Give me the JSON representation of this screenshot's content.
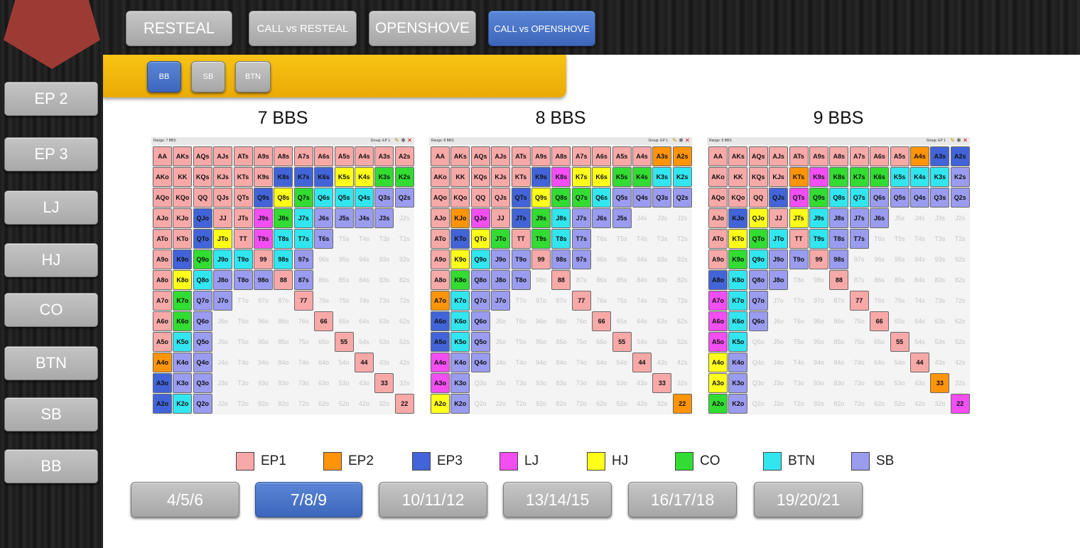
{
  "colors": {
    "EP1": "#f7a9a8",
    "EP2": "#ff9408",
    "EP3": "#4264d8",
    "LJ": "#f24ef2",
    "HJ": "#ffff19",
    "CO": "#32dc32",
    "BTN": "#32e6f0",
    "SB": "#9a9cf0"
  },
  "ranks": [
    "A",
    "K",
    "Q",
    "J",
    "T",
    "9",
    "8",
    "7",
    "6",
    "5",
    "4",
    "3",
    "2"
  ],
  "sidebar": {
    "items": [
      "EP 2",
      "EP 3",
      "LJ",
      "HJ",
      "CO",
      "BTN",
      "SB",
      "BB"
    ]
  },
  "top_tabs": [
    {
      "label": "RESTEAL",
      "active": false
    },
    {
      "label": "CALL vs RESTEAL",
      "active": false
    },
    {
      "label": "OPENSHOVE",
      "active": false
    },
    {
      "label": "CALL vs OPENSHOVE",
      "active": true
    }
  ],
  "position_tabs": [
    {
      "label": "BB",
      "active": true
    },
    {
      "label": "SB",
      "active": false
    },
    {
      "label": "BTN",
      "active": false
    }
  ],
  "grids": [
    {
      "title": "7 BBS",
      "range_label": "Range: 7 BBS",
      "group_label": "Group: EP 1",
      "rows": [
        "EP1 EP1 EP1 EP1 EP1 EP1 EP1 EP1 EP1 EP1 EP1 EP1 EP1",
        "EP1 EP1 EP1 EP1 EP1 EP1 EP3 EP3 EP3 HJ HJ CO CO",
        "EP1 EP1 EP1 EP1 EP1 EP3 HJ CO BTN BTN BTN SB SB",
        "EP1 EP1 EP3 EP1 EP1 LJ CO BTN SB SB SB SB -",
        "EP1 EP1 EP3 HJ EP1 LJ BTN BTN SB - - - -",
        "EP1 EP3 CO BTN BTN EP1 BTN SB - - - - -",
        "EP1 HJ BTN SB SB SB EP1 SB - - - - -",
        "EP1 CO SB SB - - - EP1 - - - - -",
        "EP1 CO SB - - - - - EP1 - - - -",
        "EP1 BTN SB - - - - - - EP1 - - -",
        "EP2 SB SB - - - - - - - EP1 - -",
        "EP3 SB SB - - - - - - - - EP1 -",
        "EP3 BTN SB - - - - - - - - - EP1"
      ]
    },
    {
      "title": "8 BBS",
      "range_label": "Range: 8 BBS",
      "group_label": "Group: EP 1",
      "rows": [
        "EP1 EP1 EP1 EP1 EP1 EP1 EP1 EP1 EP1 EP1 EP1 EP2 EP2",
        "EP1 EP1 EP1 EP1 EP1 EP3 LJ HJ HJ CO CO BTN BTN",
        "EP1 EP1 EP1 EP1 EP3 HJ CO CO BTN SB SB SB SB",
        "EP1 EP2 LJ EP1 EP3 CO BTN SB SB SB - - -",
        "EP1 EP3 HJ CO EP1 CO BTN SB - - - - -",
        "EP1 HJ BTN SB SB EP1 SB SB - - - - -",
        "EP1 CO SB SB SB - EP1 - - - - - -",
        "EP2 BTN SB SB - - - EP1 - - - - -",
        "EP3 BTN SB - - - - - EP1 - - - -",
        "EP3 BTN SB - - - - - - EP1 - - -",
        "LJ SB SB - - - - - - - EP1 - -",
        "LJ SB - - - - - - - - - EP1 -",
        "HJ SB - - - - - - - - - - EP2"
      ]
    },
    {
      "title": "9 BBS",
      "range_label": "Range: 9 BBS",
      "group_label": "Group: EP 1",
      "rows": [
        "EP1 EP1 EP1 EP1 EP1 EP1 EP1 EP1 EP1 EP1 EP2 EP3 EP3",
        "EP1 EP1 EP1 EP1 EP2 LJ CO CO CO BTN BTN BTN SB",
        "EP1 EP1 EP1 EP3 LJ CO BTN BTN SB SB SB SB SB",
        "EP1 EP3 HJ EP1 HJ BTN SB SB SB - - - -",
        "EP1 HJ CO BTN EP1 BTN SB SB - - - - -",
        "EP1 CO BTN SB SB EP1 SB - - - - - -",
        "EP3 BTN SB SB - - EP1 - - - - - -",
        "LJ BTN SB - - - - EP1 - - - - -",
        "LJ BTN SB - - - - - EP1 - - - -",
        "LJ BTN - - - - - - - EP1 - - -",
        "HJ SB - - - - - - - - EP1 - -",
        "HJ SB - - - - - - - - - EP2 -",
        "CO SB - - - - - - - - - - LJ"
      ]
    }
  ],
  "legend": [
    {
      "label": "EP1",
      "key": "EP1"
    },
    {
      "label": "EP2",
      "key": "EP2"
    },
    {
      "label": "EP3",
      "key": "EP3"
    },
    {
      "label": "LJ",
      "key": "LJ"
    },
    {
      "label": "HJ",
      "key": "HJ"
    },
    {
      "label": "CO",
      "key": "CO"
    },
    {
      "label": "BTN",
      "key": "BTN"
    },
    {
      "label": "SB",
      "key": "SB"
    }
  ],
  "stack_tabs": [
    {
      "label": "4/5/6",
      "active": false
    },
    {
      "label": "7/8/9",
      "active": true
    },
    {
      "label": "10/11/12",
      "active": false
    },
    {
      "label": "13/14/15",
      "active": false
    },
    {
      "label": "16/17/18",
      "active": false
    },
    {
      "label": "19/20/21",
      "active": false
    }
  ]
}
